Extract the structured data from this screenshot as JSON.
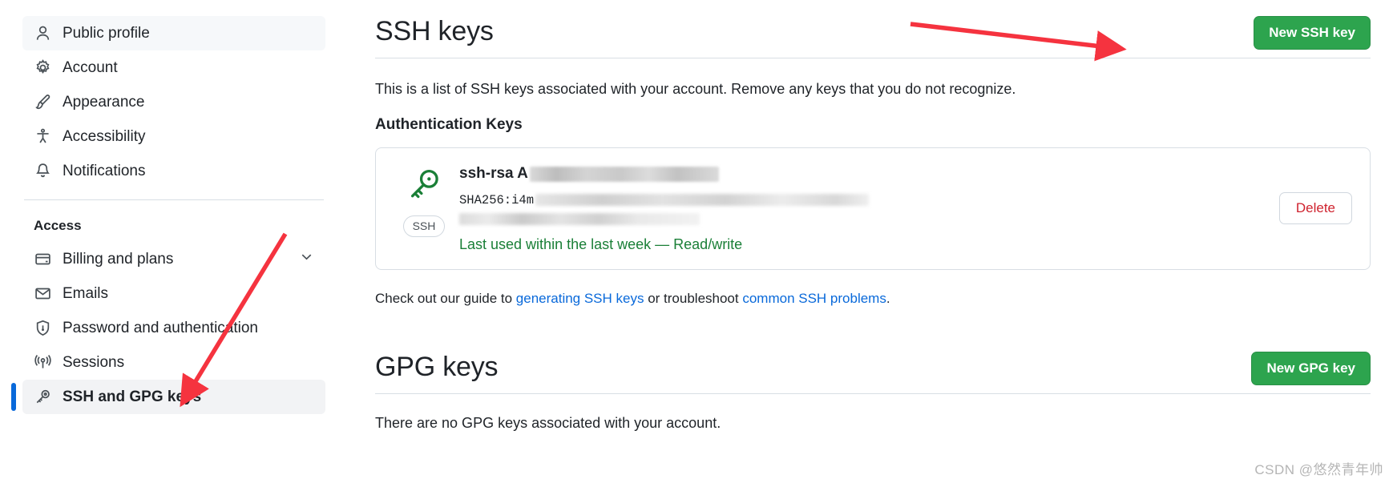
{
  "sidebar": {
    "items": [
      {
        "label": "Public profile",
        "icon": "person-icon",
        "selected": false,
        "highlighted": true
      },
      {
        "label": "Account",
        "icon": "gear-icon",
        "selected": false,
        "highlighted": false
      },
      {
        "label": "Appearance",
        "icon": "paintbrush-icon",
        "selected": false,
        "highlighted": false
      },
      {
        "label": "Accessibility",
        "icon": "accessibility-icon",
        "selected": false,
        "highlighted": false
      },
      {
        "label": "Notifications",
        "icon": "bell-icon",
        "selected": false,
        "highlighted": false
      }
    ],
    "section_title": "Access",
    "access_items": [
      {
        "label": "Billing and plans",
        "icon": "credit-card-icon",
        "selected": false,
        "chevron": "chevron-down-icon"
      },
      {
        "label": "Emails",
        "icon": "mail-icon",
        "selected": false,
        "chevron": ""
      },
      {
        "label": "Password and authentication",
        "icon": "shield-lock-icon",
        "selected": false,
        "chevron": ""
      },
      {
        "label": "Sessions",
        "icon": "broadcast-icon",
        "selected": false,
        "chevron": ""
      },
      {
        "label": "SSH and GPG keys",
        "icon": "key-icon",
        "selected": true,
        "chevron": ""
      }
    ]
  },
  "ssh": {
    "title": "SSH keys",
    "new_key_button": "New SSH key",
    "intro": "This is a list of SSH keys associated with your account. Remove any keys that you do not recognize.",
    "subhead": "Authentication Keys",
    "key": {
      "badge": "SSH",
      "title_prefix": "ssh-rsa A",
      "fingerprint_prefix": "SHA256:i4m",
      "last_used": "Last used within the last week",
      "separator": " — ",
      "access": "Read/write",
      "delete_button": "Delete"
    },
    "guide": {
      "prefix": "Check out our guide to ",
      "link1": "generating SSH keys",
      "middle": " or troubleshoot ",
      "link2": "common SSH problems",
      "suffix": "."
    }
  },
  "gpg": {
    "title": "GPG keys",
    "new_key_button": "New GPG key",
    "intro": "There are no GPG keys associated with your account."
  },
  "watermark": "CSDN @悠然青年帅",
  "colors": {
    "green_button": "#2da44e",
    "link_blue": "#0969da",
    "delete_red": "#cf222e",
    "key_green": "#1a7f37",
    "arrow_red": "#f5333f",
    "selected_bar": "#0969da"
  }
}
